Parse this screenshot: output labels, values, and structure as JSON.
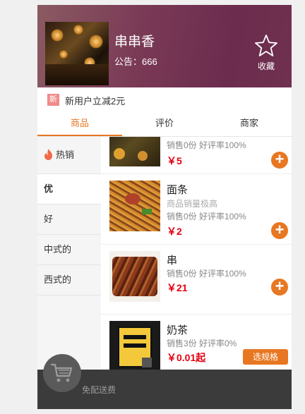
{
  "shop": {
    "name": "串串香",
    "notice": "公告：666",
    "fav_label": "收藏"
  },
  "promo": {
    "badge": "新",
    "text": "新用户立减2元"
  },
  "tabs": [
    {
      "label": "商品",
      "active": true
    },
    {
      "label": "评价",
      "active": false
    },
    {
      "label": "商家",
      "active": false
    }
  ],
  "categories": [
    {
      "label": "热销",
      "icon": "flame-icon"
    },
    {
      "label": "优",
      "active": true
    },
    {
      "label": "好"
    },
    {
      "label": "中式的"
    },
    {
      "label": "西式的"
    }
  ],
  "products": [
    {
      "name": "",
      "desc": "",
      "sales": "销售0份 好评率100%",
      "price": "￥5",
      "action": "add"
    },
    {
      "name": "面条",
      "desc": "商品销量极高",
      "sales": "销售0份 好评率100%",
      "price": "￥2",
      "action": "add"
    },
    {
      "name": "串",
      "desc": "",
      "sales": "销售0份 好评率100%",
      "price": "￥21",
      "action": "add"
    },
    {
      "name": "奶茶",
      "desc": "",
      "sales": "销售3份 好评率0%",
      "price": "￥0.01起",
      "action": "spec",
      "action_label": "选规格"
    }
  ],
  "cart": {
    "shipping": "免配送费"
  },
  "colors": {
    "accent": "#e87722",
    "price": "#e60012",
    "header": "#6b2c4e",
    "cartbar": "#3b3b3b"
  }
}
